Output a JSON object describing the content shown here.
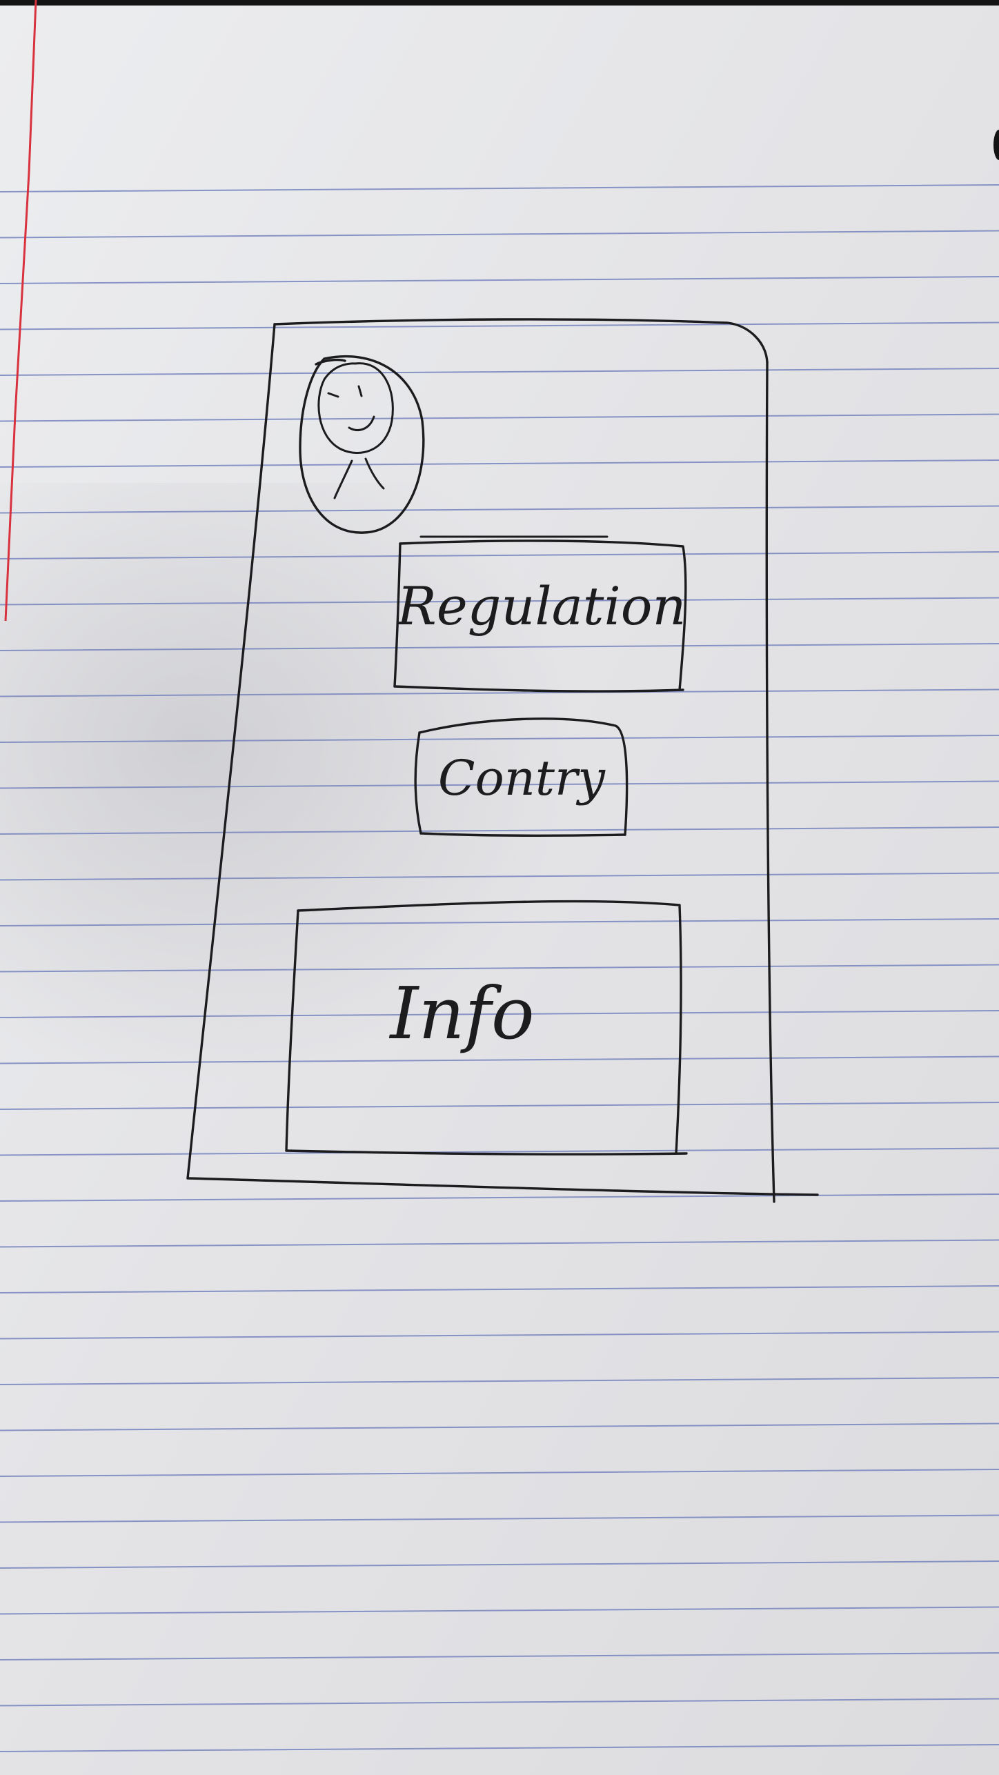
{
  "sketch": {
    "buttons": [
      {
        "label": "Regulation"
      },
      {
        "label": "Contry"
      }
    ],
    "info_panel": {
      "label": "Info"
    },
    "avatar": {
      "icon": "smiley-person-icon"
    }
  },
  "colors": {
    "paper": "#e3e3e6",
    "ruled_line": "#7684bd",
    "margin_line": "#d8323e",
    "ink": "#1c1c1e",
    "top_edge": "#141414"
  }
}
